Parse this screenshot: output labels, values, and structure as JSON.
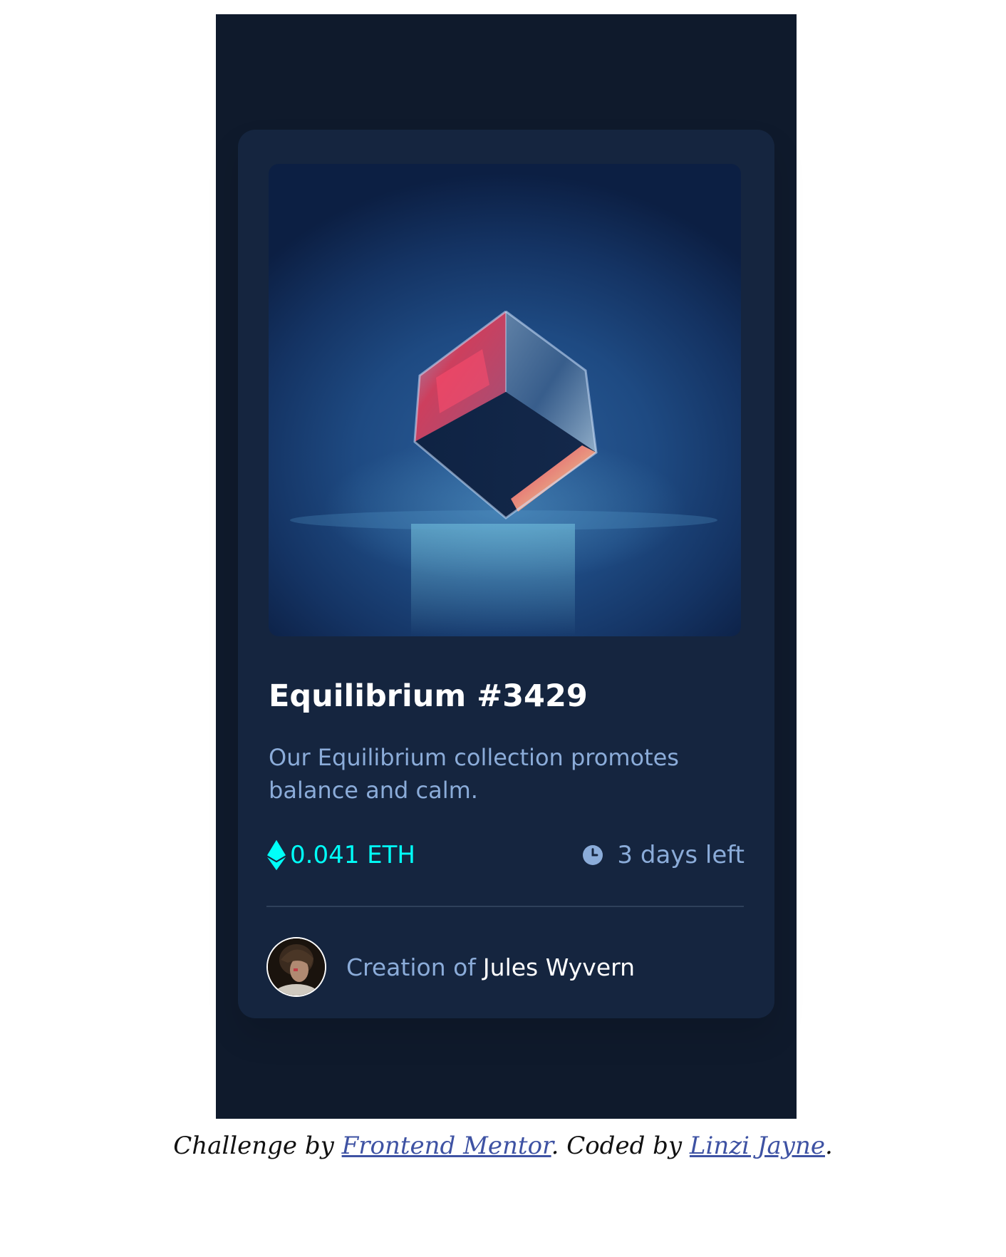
{
  "card": {
    "image_alt": "Equilibrium cube",
    "title": "Equilibrium #3429",
    "description": "Our Equilibrium collection promotes balance and calm.",
    "price": "0.041 ETH",
    "time_left": "3 days left",
    "creator_prefix": "Creation of",
    "creator_name": "Jules Wyvern",
    "icons": {
      "price": "ethereum-icon",
      "time": "clock-icon"
    }
  },
  "footer": {
    "prefix": "Challenge by",
    "link1": "Frontend Mentor",
    "middle": ". Coded by",
    "link2": "Linzi Jayne",
    "suffix": "."
  },
  "colors": {
    "page_bg": "#0f1a2c",
    "card_bg": "#15253f",
    "accent_cyan": "#00fff8",
    "soft_blue": "#8bacd9",
    "white": "#ffffff",
    "link": "#3e52a3"
  }
}
